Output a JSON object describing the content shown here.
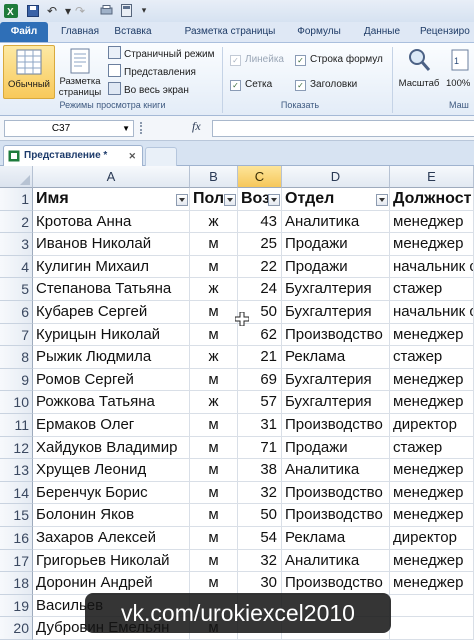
{
  "quick_access": {
    "icons": [
      "excel-icon",
      "save-icon",
      "undo-icon",
      "redo-icon",
      "print-preview-icon",
      "customize-icon"
    ]
  },
  "tabs": [
    {
      "label": "Файл"
    },
    {
      "label": "Главная"
    },
    {
      "label": "Вставка"
    },
    {
      "label": "Разметка страницы"
    },
    {
      "label": "Формулы"
    },
    {
      "label": "Данные"
    },
    {
      "label": "Рецензиро"
    }
  ],
  "ribbon": {
    "views_group": {
      "label": "Режимы просмотра книги",
      "normal": "Обычный",
      "page_layout_line1": "Разметка",
      "page_layout_line2": "страницы",
      "page_mode": "Страничный режим",
      "views": "Представления",
      "fullscreen": "Во весь экран"
    },
    "show_group": {
      "label": "Показать",
      "ruler": "Линейка",
      "formula_bar": "Строка формул",
      "gridlines": "Сетка",
      "headings": "Заголовки"
    },
    "zoom_group": {
      "zoom": "Масштаб",
      "zoom_100": "100%",
      "label_partial": "Маш"
    }
  },
  "formula_bar": {
    "name_box": "C37",
    "fx": "fx",
    "value": ""
  },
  "workbook_tab": {
    "label": "Представление *"
  },
  "sheet": {
    "columns": [
      "A",
      "B",
      "C",
      "D",
      "E"
    ],
    "selected_column": "C",
    "header_row": [
      "Имя",
      "Пол",
      "Воз",
      "Отдел",
      "Должност"
    ],
    "rows": [
      {
        "n": "2",
        "name": "Кротова Анна",
        "sex": "ж",
        "age": "43",
        "dept": "Аналитика",
        "role": "менеджер"
      },
      {
        "n": "3",
        "name": "Иванов Николай",
        "sex": "м",
        "age": "25",
        "dept": "Продажи",
        "role": "менеджер"
      },
      {
        "n": "4",
        "name": "Кулигин Михаил",
        "sex": "м",
        "age": "22",
        "dept": "Продажи",
        "role": "начальник с"
      },
      {
        "n": "5",
        "name": "Степанова Татьяна",
        "sex": "ж",
        "age": "24",
        "dept": "Бухгалтерия",
        "role": "стажер"
      },
      {
        "n": "6",
        "name": "Кубарев Сергей",
        "sex": "м",
        "age": "50",
        "dept": "Бухгалтерия",
        "role": "начальник с"
      },
      {
        "n": "7",
        "name": "Курицын Николай",
        "sex": "м",
        "age": "62",
        "dept": "Производство",
        "role": "менеджер"
      },
      {
        "n": "8",
        "name": "Рыжик Людмила",
        "sex": "ж",
        "age": "21",
        "dept": "Реклама",
        "role": "стажер"
      },
      {
        "n": "9",
        "name": "Ромов Сергей",
        "sex": "м",
        "age": "69",
        "dept": "Бухгалтерия",
        "role": "менеджер"
      },
      {
        "n": "10",
        "name": "Рожкова Татьяна",
        "sex": "ж",
        "age": "57",
        "dept": "Бухгалтерия",
        "role": "менеджер"
      },
      {
        "n": "11",
        "name": "Ермаков Олег",
        "sex": "м",
        "age": "31",
        "dept": "Производство",
        "role": "директор"
      },
      {
        "n": "12",
        "name": "Хайдуков Владимир",
        "sex": "м",
        "age": "71",
        "dept": "Продажи",
        "role": "стажер"
      },
      {
        "n": "13",
        "name": "Хрущев Леонид",
        "sex": "м",
        "age": "38",
        "dept": "Аналитика",
        "role": "менеджер"
      },
      {
        "n": "14",
        "name": "Беренчук Борис",
        "sex": "м",
        "age": "32",
        "dept": "Производство",
        "role": "менеджер"
      },
      {
        "n": "15",
        "name": "Болонин Яков",
        "sex": "м",
        "age": "50",
        "dept": "Производство",
        "role": "менеджер"
      },
      {
        "n": "16",
        "name": "Захаров Алексей",
        "sex": "м",
        "age": "54",
        "dept": "Реклама",
        "role": "директор"
      },
      {
        "n": "17",
        "name": "Григорьев Николай",
        "sex": "м",
        "age": "32",
        "dept": "Аналитика",
        "role": "менеджер"
      },
      {
        "n": "18",
        "name": "Доронин Андрей",
        "sex": "м",
        "age": "30",
        "dept": "Производство",
        "role": "менеджер"
      },
      {
        "n": "19",
        "name": "Васильев",
        "sex": "",
        "age": "",
        "dept": "",
        "role": ""
      },
      {
        "n": "20",
        "name": "Дубровин Емельян",
        "sex": "м",
        "age": "",
        "dept": "",
        "role": ""
      }
    ]
  },
  "watermark": "vk.com/urokiexcel2010"
}
